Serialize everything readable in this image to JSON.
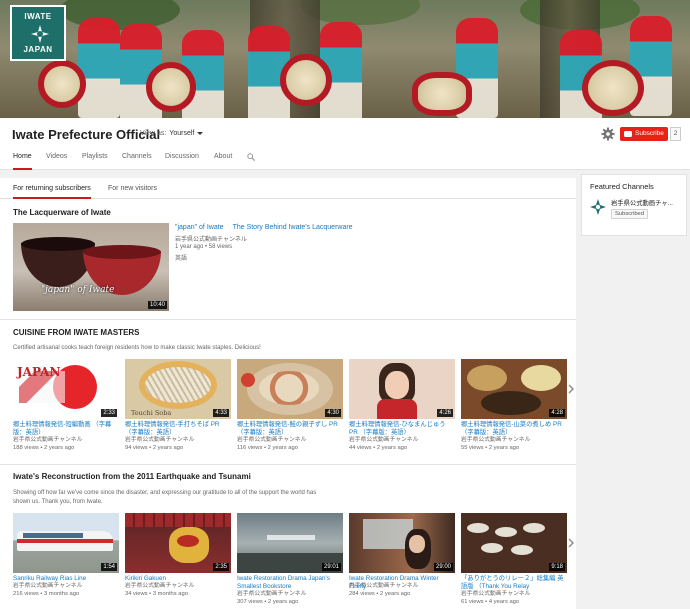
{
  "banner": {
    "logo_top": "IWATE",
    "logo_bottom": "JAPAN"
  },
  "channel": {
    "title": "Iwate Prefecture Official",
    "view_as_label": "View as:",
    "view_as_value": "Yourself",
    "subscribe_label": "Subscribe",
    "subscriber_count": "2"
  },
  "tabs": [
    {
      "label": "Home"
    },
    {
      "label": "Videos"
    },
    {
      "label": "Playlists"
    },
    {
      "label": "Channels"
    },
    {
      "label": "Discussion"
    },
    {
      "label": "About"
    }
  ],
  "subtabs": [
    {
      "label": "For returning subscribers"
    },
    {
      "label": "For new visitors"
    }
  ],
  "featured": {
    "section_title": "The Lacquerware of Iwate",
    "thumb_caption": "\"japan\" of Iwate",
    "duration": "10:40",
    "title_part1": "\"japan\" of Iwate",
    "title_part2": "The Story Behind Iwate's Lacquerware",
    "channel": "岩手県公式動画チャンネル",
    "age": "1 year ago",
    "views": "58 views",
    "language": "英語"
  },
  "sections": [
    {
      "title": "CUISINE FROM IWATE MASTERS",
      "desc": "Certified artisanal cooks teach foreign residents how to make classic Iwate staples. Delicious!",
      "videos": [
        {
          "title": "郷土料理情報発信-短編動画 （字幕版：英語）",
          "channel": "岩手県公式動画チャンネル",
          "views": "188 views",
          "age": "2 years ago",
          "duration": "2:33",
          "thumb_text": "JAPAN"
        },
        {
          "title": "郷土料理情報発信-手打ちそば PR （字幕版：英語）",
          "channel": "岩手県公式動画チャンネル",
          "views": "94 views",
          "age": "2 years ago",
          "duration": "4:33",
          "thumb_text": "Teuchi Soba"
        },
        {
          "title": "郷土料理情報発信-鮭の親子ずし PR （字幕版：英語）",
          "channel": "岩手県公式動画チャンネル",
          "views": "116 views",
          "age": "2 years ago",
          "duration": "4:30",
          "thumb_text": ""
        },
        {
          "title": "郷土料理情報発信-ひなまんじゅう PR （字幕版：英語）",
          "channel": "岩手県公式動画チャンネル",
          "views": "44 views",
          "age": "2 years ago",
          "duration": "4:26",
          "thumb_text": ""
        },
        {
          "title": "郷土料理情報発信-山菜の煮しめ PR （字幕版：英語）",
          "channel": "岩手県公式動画チャンネル",
          "views": "55 views",
          "age": "2 years ago",
          "duration": "4:28",
          "thumb_text": ""
        }
      ]
    },
    {
      "title": "Iwate's Reconstruction from the 2011 Earthquake and Tsunami",
      "desc": "Showing off how far we've come since the disaster, and expressing our gratitude to all of the support the world has shown us. Thank you, from Iwate.",
      "videos": [
        {
          "title": "Sanriku Railway Rias Line",
          "channel": "岩手県公式動画チャンネル",
          "views": "216 views",
          "age": "3 months ago",
          "duration": "1:54",
          "thumb_text": ""
        },
        {
          "title": "Kirikiri Gakuen",
          "channel": "岩手県公式動画チャンネル",
          "views": "34 views",
          "age": "3 months ago",
          "duration": "2:35",
          "thumb_text": ""
        },
        {
          "title": "Iwate Restoration Drama Japan's Smallest Bookstore",
          "channel": "岩手県公式動画チャンネル",
          "views": "307 views",
          "age": "2 years ago",
          "duration": "29:01",
          "thumb_text": ""
        },
        {
          "title": "Iwate Restoration Drama Winter Firefly",
          "channel": "岩手県公式動画チャンネル",
          "views": "284 views",
          "age": "2 years ago",
          "duration": "29:00",
          "thumb_text": ""
        },
        {
          "title": "「ありがとうのリレー２」総集編 英語版 （Thank You Relay",
          "channel": "岩手県公式動画チャンネル",
          "views": "61 views",
          "age": "4 years ago",
          "duration": "9:18",
          "thumb_text": ""
        }
      ]
    }
  ],
  "sidebar": {
    "title": "Featured Channels",
    "channel_name": "岩手県公式動画チャ...",
    "subscribed_label": "Subscribed"
  },
  "colors": {
    "accent_red": "#cc181e",
    "link_blue": "#167ac6",
    "logo_teal": "#1e6f6a"
  }
}
